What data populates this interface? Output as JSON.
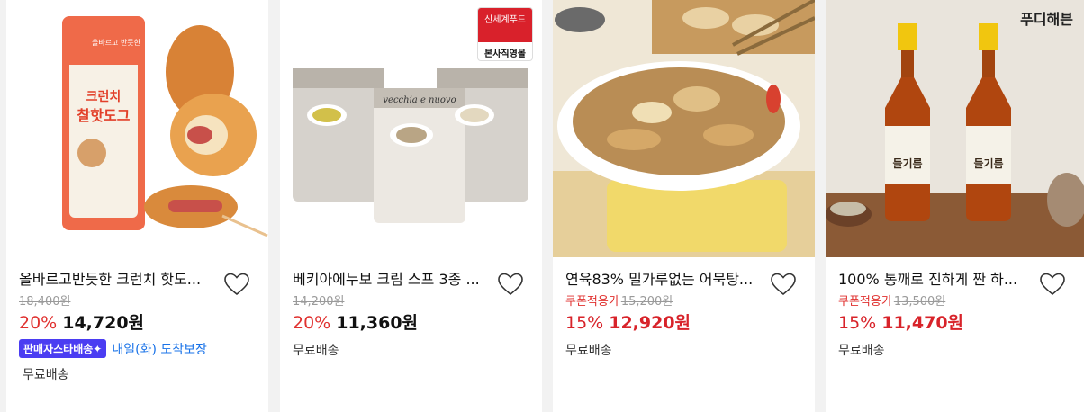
{
  "colors": {
    "discount_red": "#e0312f",
    "sale_price_red": "#d8232a",
    "badge_purple": "#4b3df2",
    "arrival_blue": "#1a73e8"
  },
  "products": [
    {
      "name": "올바르고반듯한 크런치 핫도...",
      "original_price": "18,400원",
      "discount": "20%",
      "sale_price": "14,720원",
      "seller_badge": "판매자스타배송✦",
      "arrival": "내일(화) 도착보장",
      "shipping": "무료배송",
      "image_text": "크런치 찰핫도그",
      "image_subtext": "올바르고 반듯한"
    },
    {
      "name": "베키아에누보 크림 스프 3종 ...",
      "original_price": "14,200원",
      "discount": "20%",
      "sale_price": "11,360원",
      "shipping": "무료배송",
      "logo_top": "신세계푸드",
      "logo_bottom": "본사직영몰",
      "image_text": "vecchia e nuovo"
    },
    {
      "name": "연육83% 밀가루없는 어묵탕...",
      "coupon": "쿠폰적용가",
      "original_price": "15,200원",
      "discount": "15%",
      "sale_price": "12,920원",
      "shipping": "무료배송"
    },
    {
      "name": "100% 통깨로 진하게 짠 하...",
      "coupon": "쿠폰적용가",
      "original_price": "13,500원",
      "discount": "15%",
      "sale_price": "11,470원",
      "shipping": "무료배송",
      "logo": "푸디해븐",
      "image_text": "들기름"
    }
  ]
}
